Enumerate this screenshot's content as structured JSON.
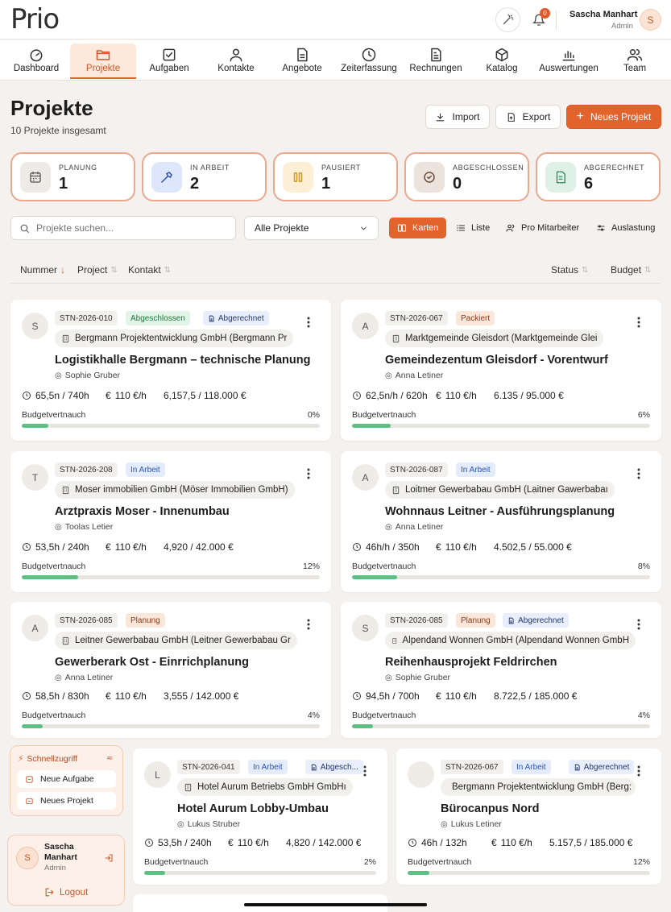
{
  "app": {
    "logo": "Prio"
  },
  "topbar": {
    "notification_count": "0",
    "user_name": "Sascha Manhart",
    "user_role": "Admin",
    "avatar_initial": "S"
  },
  "nav": [
    {
      "label": "Dashboard",
      "icon": "gauge-icon"
    },
    {
      "label": "Projekte",
      "icon": "folder-icon",
      "active": true
    },
    {
      "label": "Aufgaben",
      "icon": "checkbox-icon"
    },
    {
      "label": "Kontakte",
      "icon": "person-icon"
    },
    {
      "label": "Angebote",
      "icon": "document-icon"
    },
    {
      "label": "Zeiterfassung",
      "icon": "clock-icon"
    },
    {
      "label": "Rechnungen",
      "icon": "invoice-icon"
    },
    {
      "label": "Katalog",
      "icon": "cube-icon"
    },
    {
      "label": "Auswertungen",
      "icon": "chart-icon"
    },
    {
      "label": "Team",
      "icon": "team-icon"
    }
  ],
  "header": {
    "title": "Projekte",
    "subtitle": "10 Projekte insgesamt",
    "import_label": "Import",
    "export_label": "Export",
    "new_label": "Neues Projekt"
  },
  "stats": [
    {
      "label": "PLANUNG",
      "value": "1",
      "icon": "calendar-icon",
      "bg": "#eeeae6",
      "color": "#555555"
    },
    {
      "label": "IN ARBEIT",
      "value": "2",
      "icon": "hammer-icon",
      "bg": "#dde6fa",
      "color": "#2d4fae"
    },
    {
      "label": "PAUSIERT",
      "value": "1",
      "icon": "pause-icon",
      "bg": "#fcefd6",
      "color": "#d39a1f"
    },
    {
      "label": "ABGESCHLOSSEN",
      "value": "0",
      "icon": "check-circle-icon",
      "bg": "#ece3dc",
      "color": "#6b4a36"
    },
    {
      "label": "ABGERECHNET",
      "value": "6",
      "icon": "receipt-icon",
      "bg": "#dff1e6",
      "color": "#2d8a52"
    }
  ],
  "filters": {
    "search_placeholder": "Projekte suchen...",
    "select_value": "Alle Projekte",
    "views": [
      "Karten",
      "Liste",
      "Pro Mitarbeiter",
      "Auslastung"
    ]
  },
  "columns": {
    "nummer": "Nummer",
    "project": "Project",
    "kontakt": "Kontakt",
    "status": "Status",
    "budget": "Budget"
  },
  "budget_label": "Budgetvertnauch",
  "projects": [
    {
      "initial": "S",
      "code": "STN-2026-010",
      "tags": [
        {
          "label": "Abgeschlossen",
          "kind": "green"
        },
        {
          "label": "Abgerechnet",
          "kind": "blue2",
          "icon": true
        }
      ],
      "client": "Bergmann Projektentwicklung GmbH (Bergmann Pr",
      "title": "Logistikhalle Bergmann – technische Planung",
      "person": "Sophie Gruber",
      "hours": "65,5n / 740h",
      "rate": "110 €/h",
      "budget": "6,157,5 / 118.000 €",
      "pct": "0%",
      "progress": 0.09
    },
    {
      "initial": "A",
      "code": "STN-2026-067",
      "tags": [
        {
          "label": "Packiert",
          "kind": "orange"
        }
      ],
      "client": "Marktgemeinde Gleisdort (Marktgemeinde Glei",
      "title": "Gemeindezentum Gleisdorf - Vorentwurf",
      "person": "Anna Letiner",
      "hours": "62,5n/h / 620h",
      "rate": "110 €/h",
      "budget": "6.135 / 95.000 €",
      "pct": "6%",
      "progress": 0.13
    },
    {
      "initial": "T",
      "code": "STN-2026-208",
      "tags": [
        {
          "label": "In Arbeit",
          "kind": "blue"
        }
      ],
      "client": "Moser immobilien GmbH (Möser Immobilien GmbH)",
      "title": "Arztpraxis Moser - Innenumbau",
      "person": "Toolas Letier",
      "hours": "53,5h / 240h",
      "rate": "110 €/h",
      "budget": "4,920 / 42.000 €",
      "pct": "12%",
      "progress": 0.19
    },
    {
      "initial": "A",
      "code": "STN-2026-087",
      "tags": [
        {
          "label": "In Arbeit",
          "kind": "blue"
        }
      ],
      "client": "Loitmer Gewerbabau GmbH (Laitner Gawerbabaı",
      "title": "Wohnnaus Leitner - Ausführungsplanung",
      "person": "Anna Letiner",
      "hours": "46h/h / 350h",
      "rate": "110 €/h",
      "budget": "4.502,5 / 55.000 €",
      "pct": "8%",
      "progress": 0.15
    },
    {
      "initial": "A",
      "code": "STN-2026-085",
      "tags": [
        {
          "label": "Planung",
          "kind": "orange"
        }
      ],
      "client": "Leitner Gewerbabau GmbH (Leitner Gewerbabau Gr",
      "title": "Gewerberark Ost - Einrrichplanung",
      "person": "Anna Letiner",
      "hours": "58,5h / 830h",
      "rate": "110 €/h",
      "budget": "3,555 / 142.000 €",
      "pct": "4%",
      "progress": 0.07
    },
    {
      "initial": "S",
      "code": "STN-2026-085",
      "tags": [
        {
          "label": "Planung",
          "kind": "orange"
        },
        {
          "label": "Abgerechnet",
          "kind": "blue2",
          "icon": true
        }
      ],
      "client": "Alpendand Wonnen GmbH (Alpendand Wonnen GmbH",
      "title": "Reihenhausprojekt Feldrirchen",
      "person": "Sophie Gruber",
      "hours": "94,5h / 700h",
      "rate": "110 €/h",
      "budget": "8.722,5 / 185.000 €",
      "pct": "4%",
      "progress": 0.07
    },
    {
      "initial": "L",
      "code": "STN-2026-041",
      "tags": [
        {
          "label": "In Arbeit",
          "kind": "blue"
        },
        {
          "label": "Abgesch...",
          "kind": "blue2",
          "icon": true
        }
      ],
      "client": "Hotel Aurum Betriebs GmbH GmbHı",
      "title": "Hotel Aurum Lobby-Umbau",
      "person": "Lukus Struber",
      "hours": "53,5h / 240h",
      "rate": "110 €/h",
      "budget": "4,820 / 142.000 €",
      "pct": "2%",
      "progress": 0.09
    },
    {
      "initial": "",
      "code": "STN-2026-067",
      "tags": [
        {
          "label": "In Arbeit",
          "kind": "blue"
        },
        {
          "label": "Abgerechnet",
          "kind": "blue2",
          "icon": true
        }
      ],
      "client": "Bergmann Projektentwicklung GmbH (Berg:",
      "title": "Bürocanpus Nord",
      "person": "Lukus Letiner",
      "hours": "46h / 132h",
      "rate": "110 €/h",
      "budget": "5.157,5 / 185.000 €",
      "pct": "12%",
      "progress": 0.09
    }
  ],
  "quick_access": {
    "title": "Schnellzugriff",
    "items": [
      "Neue Aufgabe",
      "Neues Projekt"
    ]
  },
  "sidebar_user": {
    "name": "Sascha Manhart",
    "role": "Admin",
    "initial": "S",
    "logout": "Logout"
  }
}
